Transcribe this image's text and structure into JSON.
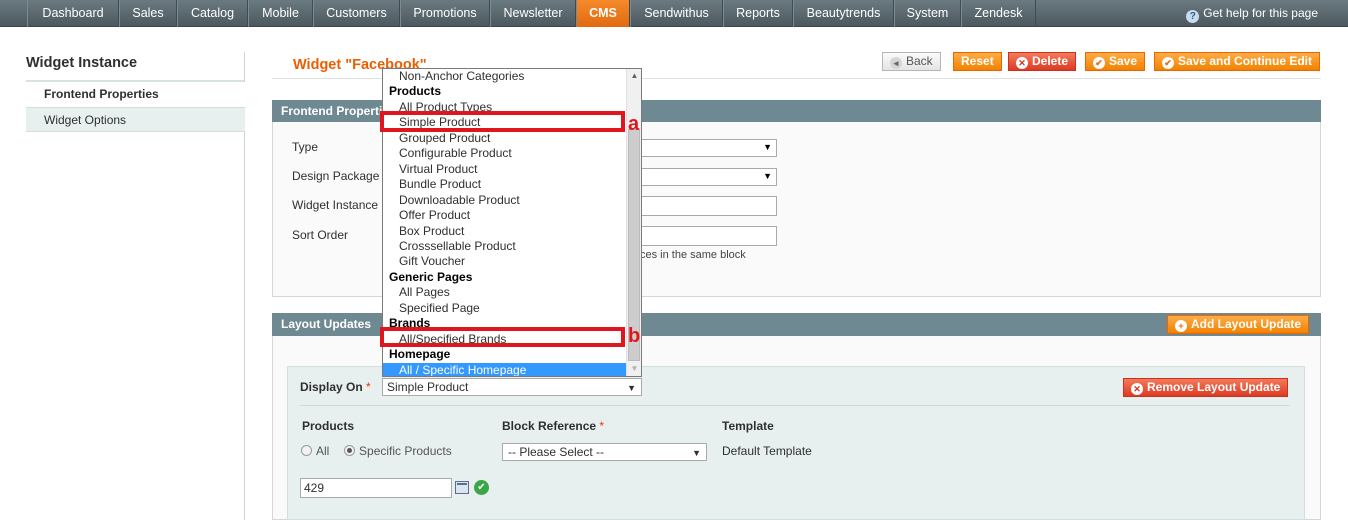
{
  "nav": {
    "items": [
      "Dashboard",
      "Sales",
      "Catalog",
      "Mobile",
      "Customers",
      "Promotions",
      "Newsletter",
      "CMS",
      "Sendwithus",
      "Reports",
      "Beautytrends",
      "System",
      "Zendesk"
    ],
    "help": "Get help for this page"
  },
  "sidebar": {
    "title": "Widget Instance",
    "items": [
      "Frontend Properties",
      "Widget Options"
    ]
  },
  "header": {
    "title": "Widget \"Facebook\"",
    "buttons": {
      "back": "Back",
      "reset": "Reset",
      "delete": "Delete",
      "save": "Save",
      "save_continue": "Save and Continue Edit"
    }
  },
  "frontend": {
    "title": "Frontend Properties",
    "labels": [
      "Type",
      "Design Package",
      "Widget Instance",
      "Sort Order"
    ],
    "note": "ces in the same block"
  },
  "layout_updates": {
    "title": "Layout Updates",
    "add_button": "Add Layout Update",
    "remove_button": "Remove Layout Update",
    "display_on_label": "Display On",
    "display_on_value": "Simple Product",
    "products_label": "Products",
    "radio_all": "All",
    "radio_specific": "Specific Products",
    "block_ref_label": "Block Reference",
    "block_ref_value": "-- Please Select --",
    "template_label": "Template",
    "template_value": "Default Template",
    "product_ids": "429"
  },
  "dropdown": {
    "rows": [
      {
        "text": "Non-Anchor Categories",
        "kind": "opt"
      },
      {
        "text": "Products",
        "kind": "grp"
      },
      {
        "text": "All Product Types",
        "kind": "opt"
      },
      {
        "text": "Simple Product",
        "kind": "opt"
      },
      {
        "text": "Grouped Product",
        "kind": "opt"
      },
      {
        "text": "Configurable Product",
        "kind": "opt"
      },
      {
        "text": "Virtual Product",
        "kind": "opt"
      },
      {
        "text": "Bundle Product",
        "kind": "opt"
      },
      {
        "text": "Downloadable Product",
        "kind": "opt"
      },
      {
        "text": "Offer Product",
        "kind": "opt"
      },
      {
        "text": "Box Product",
        "kind": "opt"
      },
      {
        "text": "Crosssellable Product",
        "kind": "opt"
      },
      {
        "text": "Gift Voucher",
        "kind": "opt"
      },
      {
        "text": "Generic Pages",
        "kind": "grp"
      },
      {
        "text": "All Pages",
        "kind": "opt"
      },
      {
        "text": "Specified Page",
        "kind": "opt"
      },
      {
        "text": "Brands",
        "kind": "grp"
      },
      {
        "text": "All/Specified Brands",
        "kind": "opt"
      },
      {
        "text": "Homepage",
        "kind": "grp"
      },
      {
        "text": "All / Specific Homepage",
        "kind": "sel"
      }
    ]
  },
  "annotations": {
    "label_a": "a",
    "label_b": "b",
    "color": "#e0161e"
  },
  "colors": {
    "accent": "#eb5e00",
    "active_tab": "#f07a1c",
    "section_header": "#6f8992"
  }
}
